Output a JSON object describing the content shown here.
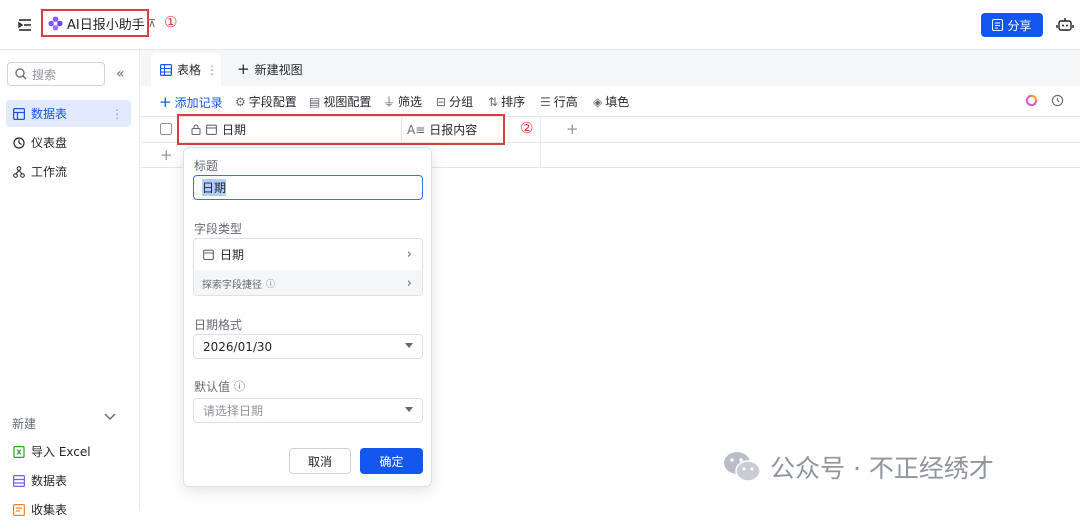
{
  "app": {
    "title": "AI日报小助手",
    "pin_glyph": "⊼",
    "share_label": "分享"
  },
  "annotations": {
    "one": "①",
    "two": "②"
  },
  "sidebar": {
    "search_placeholder": "搜索",
    "items": [
      {
        "label": "数据表",
        "icon": "table-icon",
        "active": true
      },
      {
        "label": "仪表盘",
        "icon": "dashboard-icon",
        "active": false
      },
      {
        "label": "工作流",
        "icon": "workflow-icon",
        "active": false
      }
    ],
    "new_section_label": "新建",
    "new_items": [
      {
        "label": "导入 Excel",
        "icon": "excel-icon"
      },
      {
        "label": "数据表",
        "icon": "table-icon"
      },
      {
        "label": "收集表",
        "icon": "form-icon"
      }
    ]
  },
  "views": {
    "tabs": [
      {
        "label": "表格"
      }
    ],
    "new_view_label": "新建视图"
  },
  "toolbar": {
    "add_record": "添加记录",
    "field_config": "字段配置",
    "view_config": "视图配置",
    "filter": "筛选",
    "group": "分组",
    "sort": "排序",
    "row_height": "行高",
    "fill_color": "填色"
  },
  "grid": {
    "columns": [
      {
        "label": "日期",
        "icon": "calendar-icon"
      },
      {
        "label": "日报内容",
        "icon": "text-icon"
      }
    ]
  },
  "field_popover": {
    "title_label": "标题",
    "title_value": "日期",
    "type_label": "字段类型",
    "type_value": "日期",
    "explore_label": "探索字段捷径",
    "format_label": "日期格式",
    "format_value": "2026/01/30",
    "default_label": "默认值",
    "default_placeholder": "请选择日期",
    "cancel": "取消",
    "confirm": "确定"
  },
  "watermark": {
    "text": "公众号 · 不正经绣才"
  },
  "colors": {
    "accent": "#1456f0",
    "annotation_red": "#e03b3b",
    "active_bg": "#e1eaff"
  }
}
